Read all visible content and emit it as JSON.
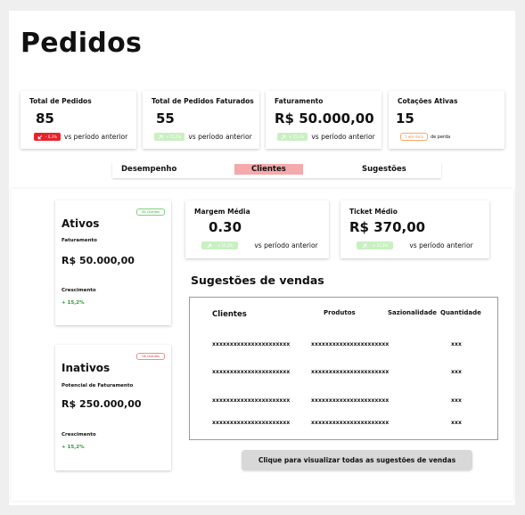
{
  "page_title": "Pedidos",
  "kpis": [
    {
      "label": "Total de Pedidos",
      "value": "85",
      "chip": "- 0,3%",
      "chip_icon": "arrow-down-left-icon",
      "chip_color": "#e8232a",
      "note": "vs período anterior"
    },
    {
      "label": "Total de Pedidos Faturados",
      "value": "55",
      "chip": "+ 15,2%",
      "chip_icon": "arrow-up-right-icon",
      "chip_color": "#c9f0c2",
      "note": "vs período anterior"
    },
    {
      "label": "Faturamento",
      "value": "R$ 50.000,00",
      "chip": "+ 15,2%",
      "chip_icon": "arrow-up-right-icon",
      "chip_color": "#c9f0c2",
      "note": "vs período anterior"
    },
    {
      "label": "Cotações Ativas",
      "value": "15",
      "chip": "7 em risco",
      "chip_color": "#f5a86a",
      "note": "de perda"
    }
  ],
  "tabs": [
    {
      "label": "Desempenho",
      "active": false
    },
    {
      "label": "Clientes",
      "active": true
    },
    {
      "label": "Sugestões",
      "active": false
    }
  ],
  "status_cards": [
    {
      "title": "Ativos",
      "badge": "85 Clientes",
      "badge_color": "#3fa24a",
      "sub_label": "Faturamento",
      "amount": "R$ 50.000,00",
      "growth_label": "Crescimento",
      "growth": "+ 15,2%"
    },
    {
      "title": "Inativos",
      "badge": "08 Clientes",
      "badge_color": "#d9363e",
      "sub_label": "Potencial de Faturamento",
      "amount": "R$ 250.000,00",
      "growth_label": "Crescimento",
      "growth": "+ 15,2%"
    }
  ],
  "metric_cards": [
    {
      "label": "Margem Média",
      "value": "0.30",
      "chip": "+ 15,2%",
      "chip_icon": "arrow-up-right-icon",
      "note": "vs período anterior"
    },
    {
      "label": "Ticket Médio",
      "value": "R$ 370,00",
      "chip": "+ 15,2%",
      "chip_icon": "arrow-up-right-icon",
      "note": "vs período anterior"
    }
  ],
  "suggestions": {
    "title": "Sugestões de vendas",
    "headers": [
      "Clientes",
      "Produtos",
      "Sazionalidade",
      "Quantidade"
    ],
    "rows": [
      [
        "xxxxxxxxxxxxxxxxxxxxxx",
        "xxxxxxxxxxxxxxxxxxxxxx",
        "",
        "xxx"
      ],
      [
        "xxxxxxxxxxxxxxxxxxxxxx",
        "xxxxxxxxxxxxxxxxxxxxxx",
        "",
        "xxx"
      ],
      [
        "xxxxxxxxxxxxxxxxxxxxxx",
        "xxxxxxxxxxxxxxxxxxxxxx",
        "",
        "xxx"
      ],
      [
        "xxxxxxxxxxxxxxxxxxxxxx",
        "xxxxxxxxxxxxxxxxxxxxxx",
        "",
        "xxx"
      ]
    ],
    "cta_label": "Clique para visualizar todas as sugestões de vendas"
  }
}
